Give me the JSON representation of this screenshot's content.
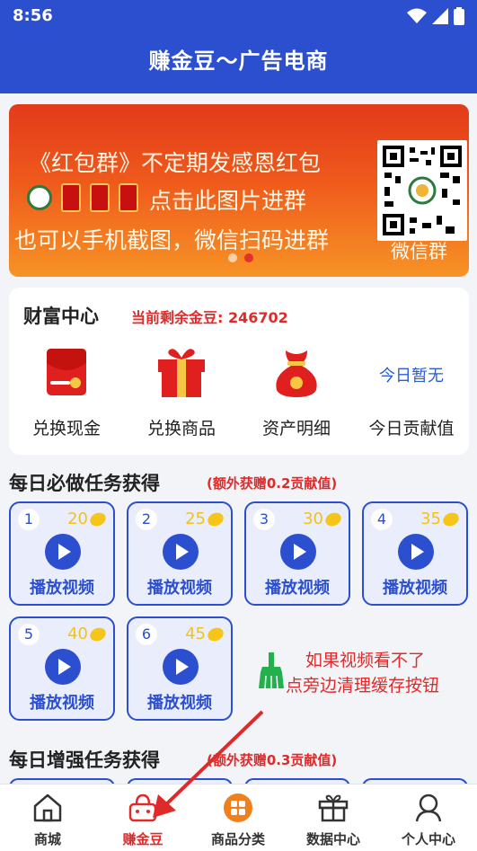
{
  "status": {
    "time": "8:56"
  },
  "header": {
    "title": "赚金豆～广告电商"
  },
  "banner": {
    "line1": "《红包群》不定期发感恩红包",
    "line2": "点击此图片进群",
    "line3": "也可以手机截图，微信扫码进群",
    "qr_caption": "微信群"
  },
  "wealth": {
    "title": "财富中心",
    "balance": "当前剩余金豆: 246702",
    "items": [
      {
        "label": "兑换现金",
        "icon": "red-envelope-icon"
      },
      {
        "label": "兑换商品",
        "icon": "gift-box-icon"
      },
      {
        "label": "资产明细",
        "icon": "money-bag-icon"
      },
      {
        "label": "今日贡献值",
        "value": "今日暂无"
      }
    ]
  },
  "daily": {
    "title": "每日必做任务获得",
    "note": "(额外获赠0.2贡献值)",
    "tasks": [
      {
        "num": "1",
        "beans": "20",
        "label": "播放视频"
      },
      {
        "num": "2",
        "beans": "25",
        "label": "播放视频"
      },
      {
        "num": "3",
        "beans": "30",
        "label": "播放视频"
      },
      {
        "num": "4",
        "beans": "35",
        "label": "播放视频"
      },
      {
        "num": "5",
        "beans": "40",
        "label": "播放视频"
      },
      {
        "num": "6",
        "beans": "45",
        "label": "播放视频"
      }
    ]
  },
  "hint": {
    "line1": "如果视频看不了",
    "line2": "点旁边清理缓存按钮"
  },
  "enhanced": {
    "title": "每日增强任务获得",
    "note": "(额外获赠0.3贡献值)"
  },
  "tabbar": {
    "items": [
      {
        "label": "商城",
        "icon": "home-icon"
      },
      {
        "label": "赚金豆",
        "icon": "basket-icon"
      },
      {
        "label": "商品分类",
        "icon": "category-icon"
      },
      {
        "label": "数据中心",
        "icon": "gift-icon"
      },
      {
        "label": "个人中心",
        "icon": "person-icon"
      }
    ],
    "active_index": 1
  },
  "colors": {
    "primary": "#2b4fce",
    "accent_red": "#e02a2a",
    "coin": "#f5c51a"
  }
}
